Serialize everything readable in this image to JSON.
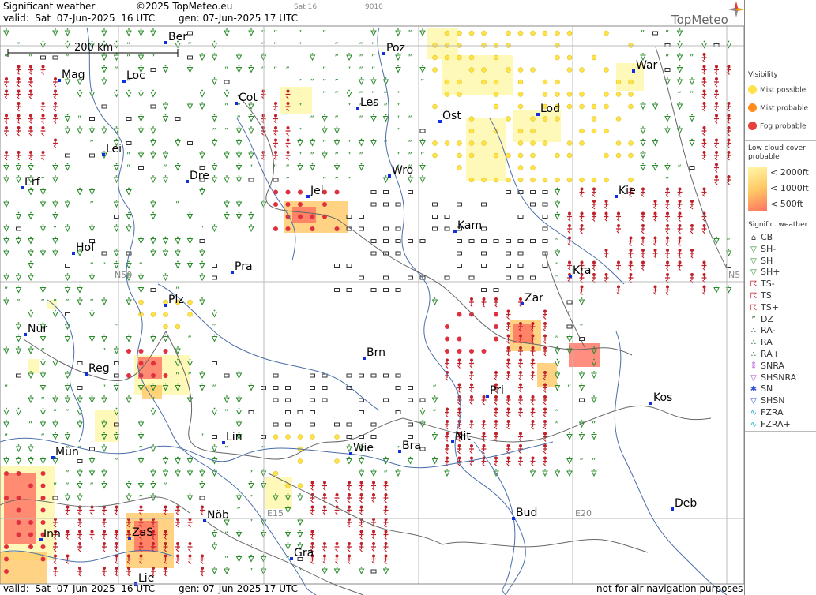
{
  "header": {
    "title": "Significant weather",
    "copyright": "©2025 TopMeteo.eu",
    "valid_label": "valid:  Sat  07-Jun-2025  16 UTC",
    "gen_label": "gen: 07-Jun-2025 17 UTC",
    "run_info": "Sat 16",
    "code": "9010",
    "brand": "TopMeteo"
  },
  "scale": {
    "label": "200 km"
  },
  "cities": [
    {
      "name": "Ber"
    },
    {
      "name": "Poz"
    },
    {
      "name": "Mag"
    },
    {
      "name": "Loc"
    },
    {
      "name": "War"
    },
    {
      "name": "Cot"
    },
    {
      "name": "Les"
    },
    {
      "name": "Lod"
    },
    {
      "name": "Ost"
    },
    {
      "name": "Lei"
    },
    {
      "name": "Erf"
    },
    {
      "name": "Dre"
    },
    {
      "name": "Wro"
    },
    {
      "name": "Jel"
    },
    {
      "name": "Kie"
    },
    {
      "name": "Kam"
    },
    {
      "name": "Hof"
    },
    {
      "name": "Pra"
    },
    {
      "name": "Kra"
    },
    {
      "name": "Plz"
    },
    {
      "name": "Zar"
    },
    {
      "name": "Nür"
    },
    {
      "name": "Brn"
    },
    {
      "name": "Reg"
    },
    {
      "name": "Pri"
    },
    {
      "name": "Kos"
    },
    {
      "name": "Lin"
    },
    {
      "name": "Nit"
    },
    {
      "name": "Mün"
    },
    {
      "name": "Wie"
    },
    {
      "name": "Bra"
    },
    {
      "name": "Deb"
    },
    {
      "name": "Nöb"
    },
    {
      "name": "Bud"
    },
    {
      "name": "ZaS"
    },
    {
      "name": "Inn"
    },
    {
      "name": "Gra"
    },
    {
      "name": "Lie"
    }
  ],
  "grid_labels": {
    "n50_left": "N50",
    "n50_right": "N5",
    "e15": "E15",
    "e20": "E20"
  },
  "legend": {
    "visibility_title": "Visibility",
    "visibility": [
      {
        "label": "Mist possible",
        "color": "#ffe24a"
      },
      {
        "label": "Mist probable",
        "color": "#ff8c1a"
      },
      {
        "label": "Fog probable",
        "color": "#e8403a"
      }
    ],
    "lowcloud_title": "Low cloud cover probable",
    "lowcloud": [
      {
        "label": "< 2000ft",
        "color": "#fff7a8"
      },
      {
        "label": "< 1000ft",
        "color": "#ffc864"
      },
      {
        "label": "<   500ft",
        "color": "#ff7060"
      }
    ],
    "sigwx_title": "Signific. weather",
    "sigwx": [
      {
        "label": "CB",
        "icon": "cb-icon"
      },
      {
        "label": "SH-",
        "icon": "shower-light-icon"
      },
      {
        "label": "SH",
        "icon": "shower-icon"
      },
      {
        "label": "SH+",
        "icon": "shower-heavy-icon"
      },
      {
        "label": "TS-",
        "icon": "thunderstorm-light-icon"
      },
      {
        "label": "TS",
        "icon": "thunderstorm-icon"
      },
      {
        "label": "TS+",
        "icon": "thunderstorm-heavy-icon"
      },
      {
        "label": "DZ",
        "icon": "drizzle-icon"
      },
      {
        "label": "RA-",
        "icon": "rain-light-icon"
      },
      {
        "label": "RA",
        "icon": "rain-icon"
      },
      {
        "label": "RA+",
        "icon": "rain-heavy-icon"
      },
      {
        "label": "SNRA",
        "icon": "snow-rain-icon"
      },
      {
        "label": "SHSNRA",
        "icon": "snow-rain-shower-icon"
      },
      {
        "label": "SN",
        "icon": "snow-icon"
      },
      {
        "label": "SHSN",
        "icon": "snow-shower-icon"
      },
      {
        "label": "FZRA",
        "icon": "freezing-rain-icon"
      },
      {
        "label": "FZRA+",
        "icon": "freezing-rain-heavy-icon"
      }
    ]
  },
  "footer": {
    "valid_label": "valid:  Sat  07-Jun-2025  16 UTC",
    "gen_label": "gen: 07-Jun-2025 17 UTC",
    "disclaimer": "not for air navigation purposes"
  }
}
